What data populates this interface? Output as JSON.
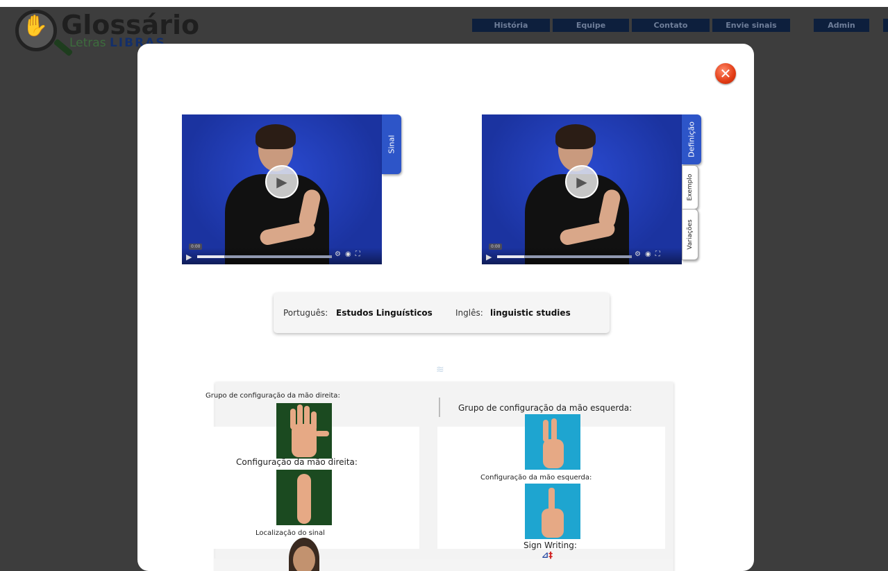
{
  "logo": {
    "title": "Glossário",
    "subtitle_prefix": "Letras",
    "subtitle_brand": "LIBRAS",
    "icon": "hand-magnifier-icon"
  },
  "nav": {
    "items": [
      "História",
      "Equipe",
      "Contato",
      "Envie sinais",
      "Admin"
    ]
  },
  "modal": {
    "close_icon": "close-icon",
    "video_left": {
      "tab_label": "Sinal",
      "time": "0:00",
      "progress": 0.2
    },
    "video_right": {
      "tabs": [
        "Definição",
        "Exemplo",
        "Variações"
      ],
      "active_tab": "Definição",
      "time": "0:00",
      "progress": 0.2
    },
    "names": {
      "pt_label": "Português:",
      "pt_value": "Estudos Linguísticos",
      "en_label": "Inglês:",
      "en_value": "linguistic studies"
    },
    "config": {
      "right_group_label": "Grupo de configuração da mão direita:",
      "left_group_label": "Grupo de configuração da mão esquerda:",
      "right_config_label": "Configuração da mão direita:",
      "left_config_label": "Configuração da mão esquerda:",
      "location_label": "Localização do sinal",
      "signwriting_label": "Sign Writing:"
    }
  },
  "colors": {
    "backdrop": "#3d3d3d",
    "nav_bg": "#0d1f3d",
    "video_bg": "#1d38a8",
    "tab_active": "#2d55c8",
    "close_red": "#e23b14"
  }
}
